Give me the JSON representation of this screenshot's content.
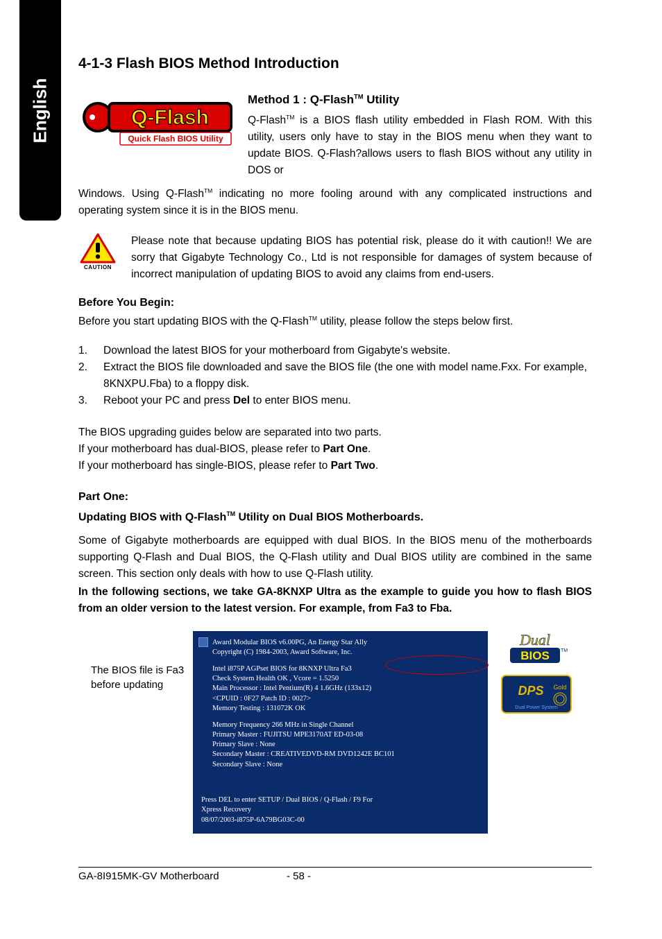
{
  "sideTab": "English",
  "sectionTitle": "4-1-3   Flash BIOS Method Introduction",
  "qflashLogo": {
    "topText": "Q-Flash",
    "subText": "Quick Flash BIOS Utility"
  },
  "method1": {
    "heading_pre": "Method 1 : Q-Flash",
    "heading_post": " Utility",
    "p1_pre": "Q-Flash",
    "p1_post": " is a BIOS flash utility embedded in Flash ROM. With this utility, users only have to stay in the BIOS menu when they want to update BIOS. Q-Flash?allows users to flash BIOS without any utility in DOS or",
    "p2_pre": "Windows. Using Q-Flash",
    "p2_post": " indicating no more fooling around with any complicated instructions and operating system since it is in the BIOS menu."
  },
  "caution": {
    "label": "CAUTION",
    "text": "Please note that because updating BIOS has potential risk, please do it with caution!! We are sorry that Gigabyte Technology Co., Ltd is not responsible for damages of system because of incorrect manipulation of updating BIOS to avoid any claims from end-users."
  },
  "before": {
    "heading": "Before You Begin:",
    "intro_pre": "Before you start updating BIOS with the Q-Flash",
    "intro_post": " utility, please follow the steps below first.",
    "steps": [
      "Download the latest BIOS for your motherboard from Gigabyte's website.",
      "Extract the BIOS file downloaded and save the BIOS file (the one with model name.Fxx. For example, 8KNXPU.Fba) to a floppy disk.",
      {
        "pre": "Reboot your PC and press ",
        "bold": "Del",
        "post": " to enter BIOS menu."
      }
    ]
  },
  "separated": {
    "l1": "The BIOS upgrading guides below are separated into two parts.",
    "l2_pre": "If your motherboard has dual-BIOS, please refer to ",
    "l2_bold": "Part One",
    "l2_post": ".",
    "l3_pre": "If your motherboard has single-BIOS, please refer to ",
    "l3_bold": "Part Two",
    "l3_post": "."
  },
  "partOne": {
    "heading": "Part One:",
    "update_pre": "Updating BIOS with Q-Flash",
    "update_post": " Utility on Dual BIOS Motherboards.",
    "para": "Some of Gigabyte motherboards are equipped with dual BIOS. In the BIOS menu of the motherboards supporting Q-Flash and Dual BIOS, the Q-Flash utility and Dual BIOS utility are combined in the same screen. This section only deals with how to use Q-Flash utility.",
    "boldPara": "In the following sections, we take GA-8KNXP Ultra as the example to guide you how to flash BIOS from an older version to the latest version. For example, from Fa3 to Fba."
  },
  "caption": "The BIOS file is Fa3 before updating",
  "bios": {
    "header1": "Award Modular BIOS v6.00PG, An Energy Star Ally",
    "header2": "Copyright  (C) 1984-2003, Award Software,  Inc.",
    "l1": "Intel i875P AGPset BIOS for 8KNXP Ultra Fa3",
    "l2": "Check System Health OK ,  Vcore = 1.5250",
    "l3": "Main Processor : Intel Pentium(R) 4   1.6GHz (133x12)",
    "l4": "<CPUID : 0F27 Patch ID   : 0027>",
    "l5": "Memory Testing   : 131072K OK",
    "m1": "Memory Frequency 266 MHz in Single Channel",
    "m2": "Primary Master : FUJITSU MPE3170AT ED-03-08",
    "m3": "Primary Slave : None",
    "m4": "Secondary Master : CREATIVEDVD-RM DVD1242E BC101",
    "m5": "Secondary Slave : None",
    "f1": "Press DEL to enter SETUP / Dual BIOS / Q-Flash / F9 For",
    "f2": "Xpress Recovery",
    "f3": "08/07/2003-i875P-6A79BG03C-00"
  },
  "rightBadges": {
    "dual_top": "Dual",
    "dual_bot": "BIOS",
    "dps_top": "DPS Gold",
    "dps_sub": "Dual Power System"
  },
  "footer": {
    "left": "GA-8I915MK-GV Motherboard",
    "center": "- 58 -"
  }
}
